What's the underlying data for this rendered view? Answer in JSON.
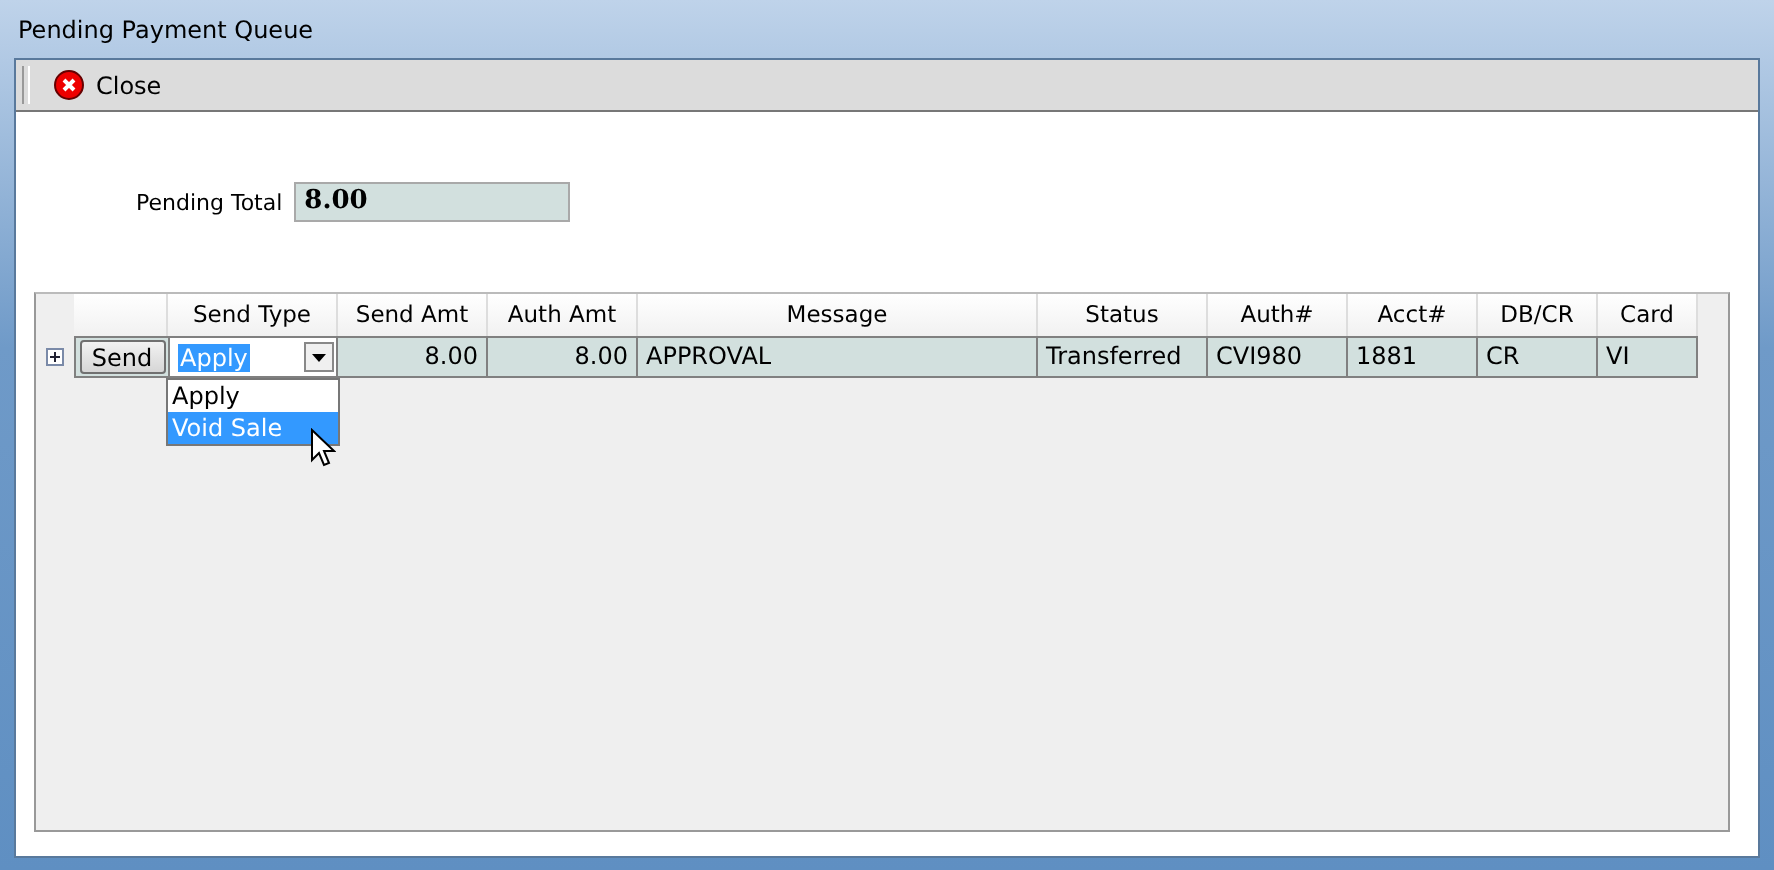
{
  "window": {
    "title": "Pending Payment Queue"
  },
  "toolbar": [
    {
      "label": "Close",
      "kind": "close"
    }
  ],
  "pending_total": {
    "label": "Pending Total",
    "value": "8.00"
  },
  "table": {
    "columns": [
      "Send Type",
      "Send Amt",
      "Auth Amt",
      "Message",
      "Status",
      "Auth#",
      "Acct#",
      "DB/CR",
      "Card"
    ],
    "rows": [
      {
        "expanded": false,
        "button": "Send",
        "send_type": "Apply",
        "send_amt": "8.00",
        "auth_amt": "8.00",
        "message": "APPROVAL",
        "status": "Transferred",
        "auth": "CVI980",
        "acct": "1881",
        "db_cr": "CR",
        "card": "VI"
      }
    ]
  },
  "dropdown": {
    "options": [
      {
        "label": "Apply",
        "selected": false
      },
      {
        "label": "Void Sale",
        "selected": true
      }
    ]
  }
}
